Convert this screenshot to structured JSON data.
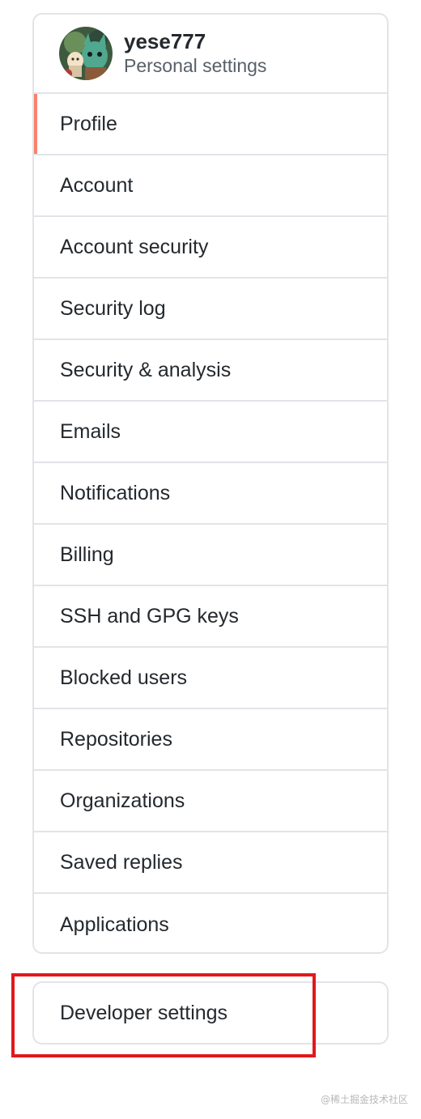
{
  "header": {
    "username": "yese777",
    "subtitle": "Personal settings",
    "avatar_icon": "anime-character-avatar"
  },
  "menu": {
    "items": [
      {
        "label": "Profile",
        "selected": true
      },
      {
        "label": "Account"
      },
      {
        "label": "Account security"
      },
      {
        "label": "Security log"
      },
      {
        "label": "Security & analysis"
      },
      {
        "label": "Emails"
      },
      {
        "label": "Notifications"
      },
      {
        "label": "Billing"
      },
      {
        "label": "SSH and GPG keys"
      },
      {
        "label": "Blocked users"
      },
      {
        "label": "Repositories"
      },
      {
        "label": "Organizations"
      },
      {
        "label": "Saved replies"
      },
      {
        "label": "Applications"
      }
    ]
  },
  "developer": {
    "label": "Developer settings"
  },
  "highlight_color": "#e0191c",
  "selected_accent_color": "#f9826c",
  "watermark": "@稀土掘金技术社区"
}
